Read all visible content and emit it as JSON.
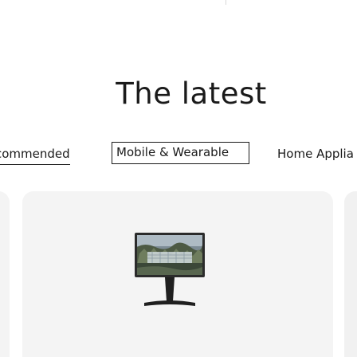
{
  "headline": "The latest",
  "tabs": [
    {
      "label": "commended",
      "state": "underlined"
    },
    {
      "label": "Mobile & Wearable",
      "state": "selected"
    },
    {
      "label": "Home Applia",
      "state": "default"
    }
  ],
  "product_card": {
    "image": "product-thumbnail-icon"
  },
  "colors": {
    "text": "#1a1a1a",
    "card_bg": "#f4f4f4",
    "page_bg": "#ffffff"
  }
}
